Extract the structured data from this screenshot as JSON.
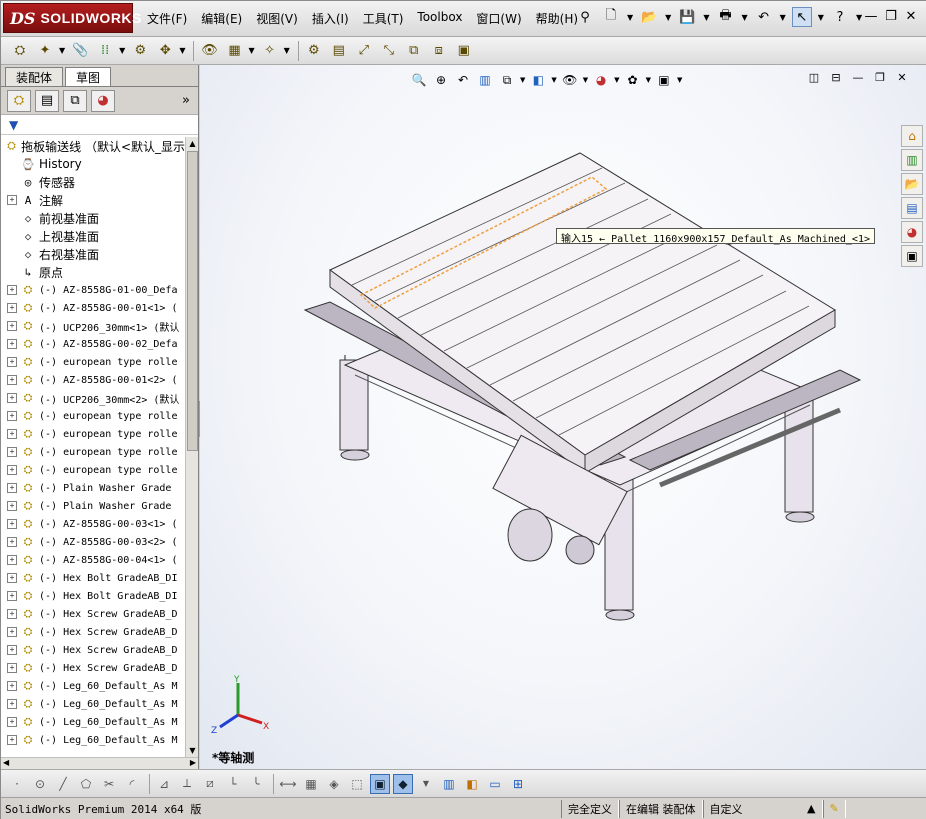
{
  "app": {
    "logo_prefix": "DS",
    "logo_name": "SOLIDWORKS"
  },
  "menu": [
    "文件(F)",
    "编辑(E)",
    "视图(V)",
    "插入(I)",
    "工具(T)",
    "Toolbox",
    "窗口(W)",
    "帮助(H)"
  ],
  "panel": {
    "tabs": [
      "装配体",
      "草图"
    ],
    "active_tab": "草图",
    "more_label": "»",
    "filter_icon": "funnel-icon"
  },
  "tree": {
    "root": "拖板输送线 （默认<默认_显示",
    "items": [
      {
        "expand": false,
        "icon": "history",
        "label": "History"
      },
      {
        "expand": false,
        "icon": "sensor",
        "label": "传感器"
      },
      {
        "expand": true,
        "icon": "annotation",
        "label": "注解"
      },
      {
        "expand": false,
        "icon": "plane",
        "label": "前视基准面"
      },
      {
        "expand": false,
        "icon": "plane",
        "label": "上视基准面"
      },
      {
        "expand": false,
        "icon": "plane",
        "label": "右视基准面"
      },
      {
        "expand": false,
        "icon": "origin",
        "label": "原点"
      },
      {
        "expand": true,
        "icon": "part",
        "label": "(-) AZ-8558G-01-00_Defa"
      },
      {
        "expand": true,
        "icon": "part",
        "label": "(-) AZ-8558G-00-01<1> ("
      },
      {
        "expand": true,
        "icon": "part",
        "label": "(-) UCP206_30mm<1> (默认"
      },
      {
        "expand": true,
        "icon": "part",
        "label": "(-) AZ-8558G-00-02_Defa"
      },
      {
        "expand": true,
        "icon": "part",
        "label": "(-) european type rolle"
      },
      {
        "expand": true,
        "icon": "part",
        "label": "(-) AZ-8558G-00-01<2> ("
      },
      {
        "expand": true,
        "icon": "part",
        "label": "(-) UCP206_30mm<2> (默认"
      },
      {
        "expand": true,
        "icon": "part",
        "label": "(-) european type rolle"
      },
      {
        "expand": true,
        "icon": "part",
        "label": "(-) european type rolle"
      },
      {
        "expand": true,
        "icon": "part",
        "label": "(-) european type rolle"
      },
      {
        "expand": true,
        "icon": "part",
        "label": "(-) european type rolle"
      },
      {
        "expand": true,
        "icon": "part",
        "label": "(-) Plain Washer Grade"
      },
      {
        "expand": true,
        "icon": "part",
        "label": "(-) Plain Washer Grade"
      },
      {
        "expand": true,
        "icon": "part",
        "label": "(-) AZ-8558G-00-03<1> ("
      },
      {
        "expand": true,
        "icon": "part",
        "label": "(-) AZ-8558G-00-03<2> ("
      },
      {
        "expand": true,
        "icon": "part",
        "label": "(-) AZ-8558G-00-04<1> ("
      },
      {
        "expand": true,
        "icon": "part",
        "label": "(-) Hex Bolt GradeAB_DI"
      },
      {
        "expand": true,
        "icon": "part",
        "label": "(-) Hex Bolt GradeAB_DI"
      },
      {
        "expand": true,
        "icon": "part",
        "label": "(-) Hex Screw GradeAB_D"
      },
      {
        "expand": true,
        "icon": "part",
        "label": "(-) Hex Screw GradeAB_D"
      },
      {
        "expand": true,
        "icon": "part",
        "label": "(-) Hex Screw GradeAB_D"
      },
      {
        "expand": true,
        "icon": "part",
        "label": "(-) Hex Screw GradeAB_D"
      },
      {
        "expand": true,
        "icon": "part",
        "label": "(-) Leg_60_Default_As M"
      },
      {
        "expand": true,
        "icon": "part",
        "label": "(-) Leg_60_Default_As M"
      },
      {
        "expand": true,
        "icon": "part",
        "label": "(-) Leg_60_Default_As M"
      },
      {
        "expand": true,
        "icon": "part",
        "label": "(-) Leg_60_Default_As M"
      }
    ]
  },
  "viewport": {
    "tooltip": "输入15 ← Pallet 1160x900x157_Default_As Machined_<1>",
    "view_name": "*等轴测",
    "triad": {
      "x": "X",
      "y": "Y",
      "z": "Z"
    }
  },
  "status": {
    "product": "SolidWorks Premium 2014 x64 版",
    "state1": "完全定义",
    "state2": "在编辑 装配体",
    "units": "自定义",
    "units_arrow": "▲"
  },
  "colors": {
    "accent": "#9fc0ea",
    "logo_red": "#b41e1e",
    "highlight_orange": "#f0a040"
  }
}
